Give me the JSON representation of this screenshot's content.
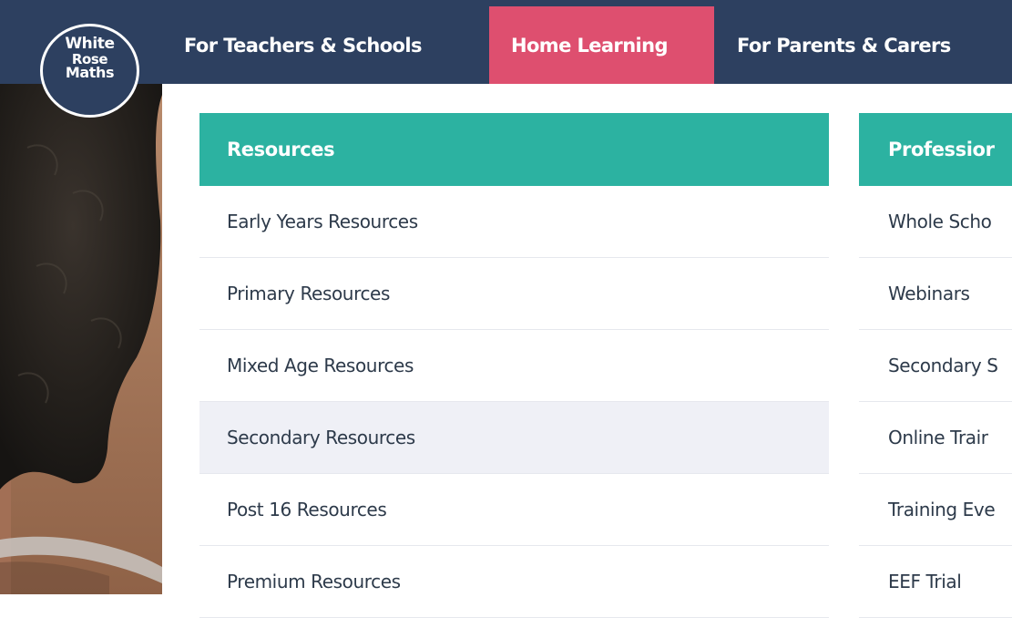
{
  "logo": {
    "line1": "White",
    "line2": "Rose",
    "line3": "Maths"
  },
  "nav": {
    "items": [
      {
        "label": "For Teachers & Schools"
      },
      {
        "label": "Home Learning",
        "active": true
      },
      {
        "label": "For Parents & Carers"
      }
    ]
  },
  "menu": {
    "resources": {
      "heading": "Resources",
      "items": [
        "Early Years Resources",
        "Primary Resources",
        "Mixed Age Resources",
        "Secondary Resources",
        "Post 16 Resources",
        "Premium Resources"
      ],
      "hovered_index": 3
    },
    "professional": {
      "heading": "Professior",
      "items": [
        "Whole Scho",
        "Webinars",
        "Secondary S",
        "Online Trair",
        "Training Eve",
        "EEF Trial"
      ]
    }
  },
  "colors": {
    "navy": "#2d4060",
    "active_pink": "#de4f6f",
    "teal": "#2cb2a1",
    "hover_bg": "#eff0f6",
    "link_text": "#2d3a4a"
  }
}
